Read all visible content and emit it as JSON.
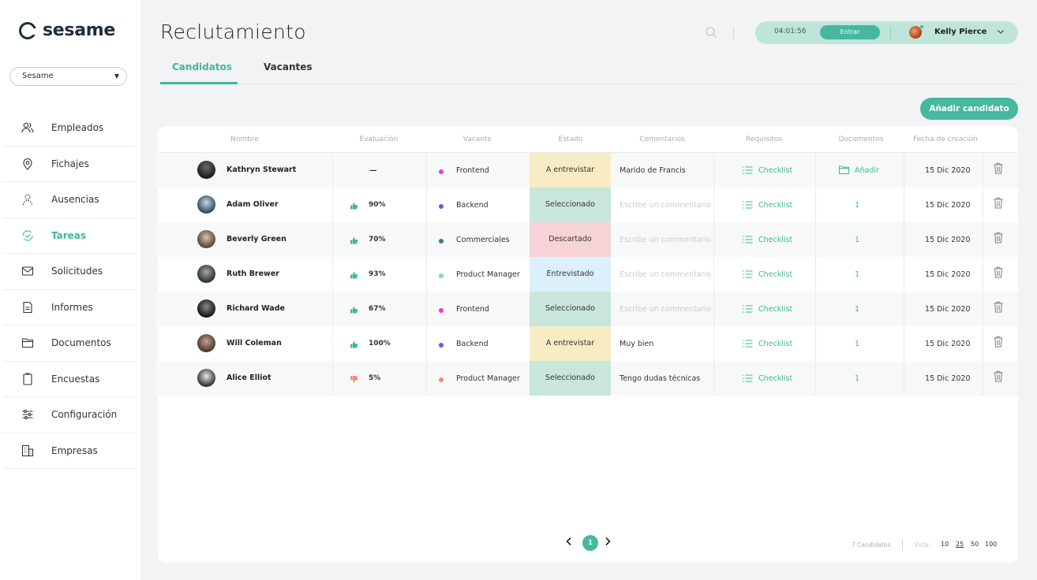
{
  "app": {
    "logo_text": "sesame",
    "company": "Sesame"
  },
  "sidebar": {
    "items": [
      {
        "label": "Empleados",
        "icon": "people-icon"
      },
      {
        "label": "Fichajes",
        "icon": "location-pin-icon"
      },
      {
        "label": "Ausencias",
        "icon": "person-dashed-icon"
      },
      {
        "label": "Tareas",
        "icon": "tasks-icon",
        "active": true
      },
      {
        "label": "Solicitudes",
        "icon": "envelope-icon"
      },
      {
        "label": "Informes",
        "icon": "document-icon"
      },
      {
        "label": "Documentos",
        "icon": "folder-icon"
      },
      {
        "label": "Encuestas",
        "icon": "clipboard-icon"
      },
      {
        "label": "Configuración",
        "icon": "sliders-icon"
      },
      {
        "label": "Empresas",
        "icon": "building-icon"
      }
    ]
  },
  "header": {
    "title": "Reclutamiento",
    "time": "04:01:56",
    "enter_label": "Entrar",
    "user_name": "Kelly Pierce"
  },
  "tabs": {
    "candidates": "Candidatos",
    "vacancies": "Vacantes"
  },
  "actions": {
    "add_candidate": "Añadir candidato"
  },
  "table": {
    "headers": {
      "name": "Nombre",
      "evaluation": "Evaluación",
      "vacancy": "Vacante",
      "status": "Estado",
      "comments": "Comentarios",
      "requirements": "Requisitos",
      "documents": "Documentos",
      "created": "Fecha de creación"
    },
    "rows": [
      {
        "name": "Kathryn Stewart",
        "evaluation": "—",
        "eval_type": "none",
        "vacancy": "Frontend",
        "vacancy_color": "#e93ad6",
        "status": "A entrevistar",
        "status_color": "#f7ecc4",
        "comment": "Marido de Francis",
        "comment_placeholder": false,
        "requirements": "Checklist",
        "documents": "Añadir",
        "doc_type": "add",
        "date": "15 Dic 2020"
      },
      {
        "name": "Adam Oliver",
        "evaluation": "90%",
        "eval_type": "up",
        "vacancy": "Backend",
        "vacancy_color": "#6a5ae0",
        "status": "Seleccionado",
        "status_color": "#c9e6dc",
        "comment": "Escribe un commentario",
        "comment_placeholder": true,
        "requirements": "Checklist",
        "documents": "1",
        "doc_type": "count",
        "date": "15 Dic 2020"
      },
      {
        "name": "Beverly Green",
        "evaluation": "70%",
        "eval_type": "up",
        "vacancy": "Commerciales",
        "vacancy_color": "#3a7d8c",
        "status": "Descartado",
        "status_color": "#f6d3d6",
        "comment": "Escribe un commentario",
        "comment_placeholder": true,
        "requirements": "Checklist",
        "documents": "1",
        "doc_type": "count",
        "date": "15 Dic 2020"
      },
      {
        "name": "Ruth Brewer",
        "evaluation": "93%",
        "eval_type": "up",
        "vacancy": "Product Manager",
        "vacancy_color": "#7fd3ea",
        "status": "Entrevistado",
        "status_color": "#dcf0fb",
        "comment": "Escribe un commentario",
        "comment_placeholder": true,
        "requirements": "Checklist",
        "documents": "1",
        "doc_type": "count",
        "date": "15 Dic 2020"
      },
      {
        "name": "Richard Wade",
        "evaluation": "67%",
        "eval_type": "up",
        "vacancy": "Frontend",
        "vacancy_color": "#e93ad6",
        "status": "Seleccionado",
        "status_color": "#c9e6dc",
        "comment": "Escribe un commentario",
        "comment_placeholder": true,
        "requirements": "Checklist",
        "documents": "1",
        "doc_type": "count",
        "date": "15 Dic 2020"
      },
      {
        "name": "Will Coleman",
        "evaluation": "100%",
        "eval_type": "up",
        "vacancy": "Backend",
        "vacancy_color": "#6a5ae0",
        "status": "A entrevistar",
        "status_color": "#f7ecc4",
        "comment": "Muy bien",
        "comment_placeholder": false,
        "requirements": "Checklist",
        "documents": "1",
        "doc_type": "count",
        "date": "15 Dic 2020"
      },
      {
        "name": "Alice Elliot",
        "evaluation": "5%",
        "eval_type": "down",
        "vacancy": "Product Manager",
        "vacancy_color": "#f08a84",
        "status": "Seleccionado",
        "status_color": "#c9e6dc",
        "comment": "Tengo dudas técnicas",
        "comment_placeholder": false,
        "requirements": "Checklist",
        "documents": "1",
        "doc_type": "count",
        "date": "15 Dic 2020"
      }
    ]
  },
  "pagination": {
    "current_page": "1",
    "count_text": "7 Candidatos",
    "view_label": "Vista:",
    "view_options": [
      "10",
      "25",
      "50",
      "100"
    ],
    "view_selected": "25"
  },
  "colors": {
    "accent": "#3fb79d",
    "accent_dark": "#45b89e",
    "pill": "#bfe5da"
  }
}
